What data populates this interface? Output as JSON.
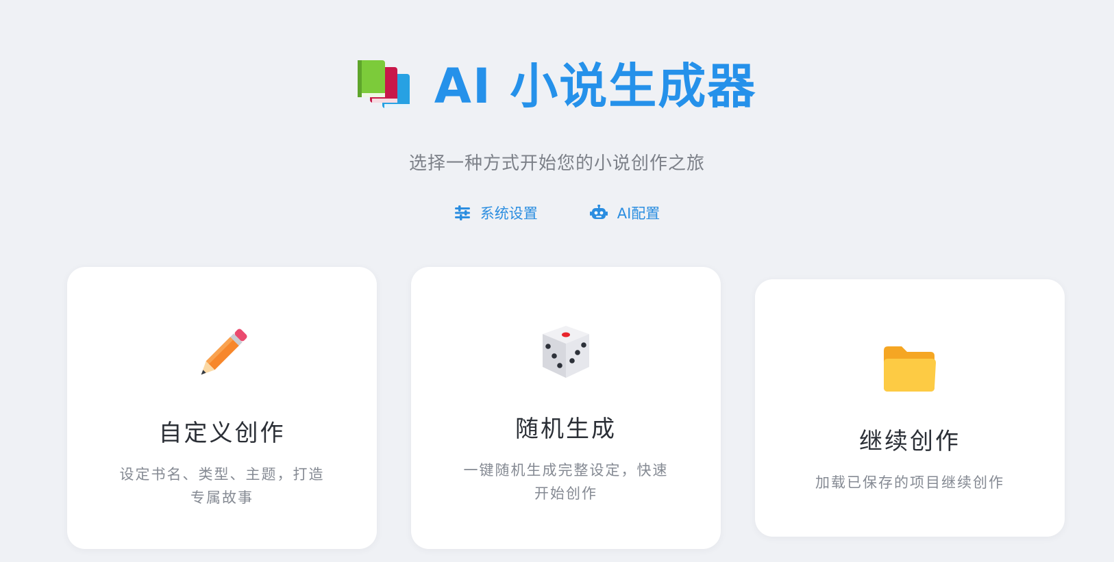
{
  "header": {
    "title": "AI 小说生成器",
    "subtitle": "选择一种方式开始您的小说创作之旅",
    "icon": "books-icon"
  },
  "top_actions": [
    {
      "label": "系统设置",
      "icon": "sliders-icon"
    },
    {
      "label": "AI配置",
      "icon": "robot-icon"
    }
  ],
  "cards": [
    {
      "title": "自定义创作",
      "description_lines": [
        "设定书名、类型、主题，打造",
        "专属故事"
      ],
      "icon": "pencil-icon"
    },
    {
      "title": "随机生成",
      "description_lines": [
        "一键随机生成完整设定，快速",
        "开始创作"
      ],
      "icon": "dice-icon"
    },
    {
      "title": "继续创作",
      "description_lines": [
        "加载已保存的项目继续创作"
      ],
      "icon": "folder-icon"
    }
  ],
  "colors": {
    "background": "#eff1f5",
    "accent": "#2591ea",
    "card_background": "#ffffff"
  }
}
